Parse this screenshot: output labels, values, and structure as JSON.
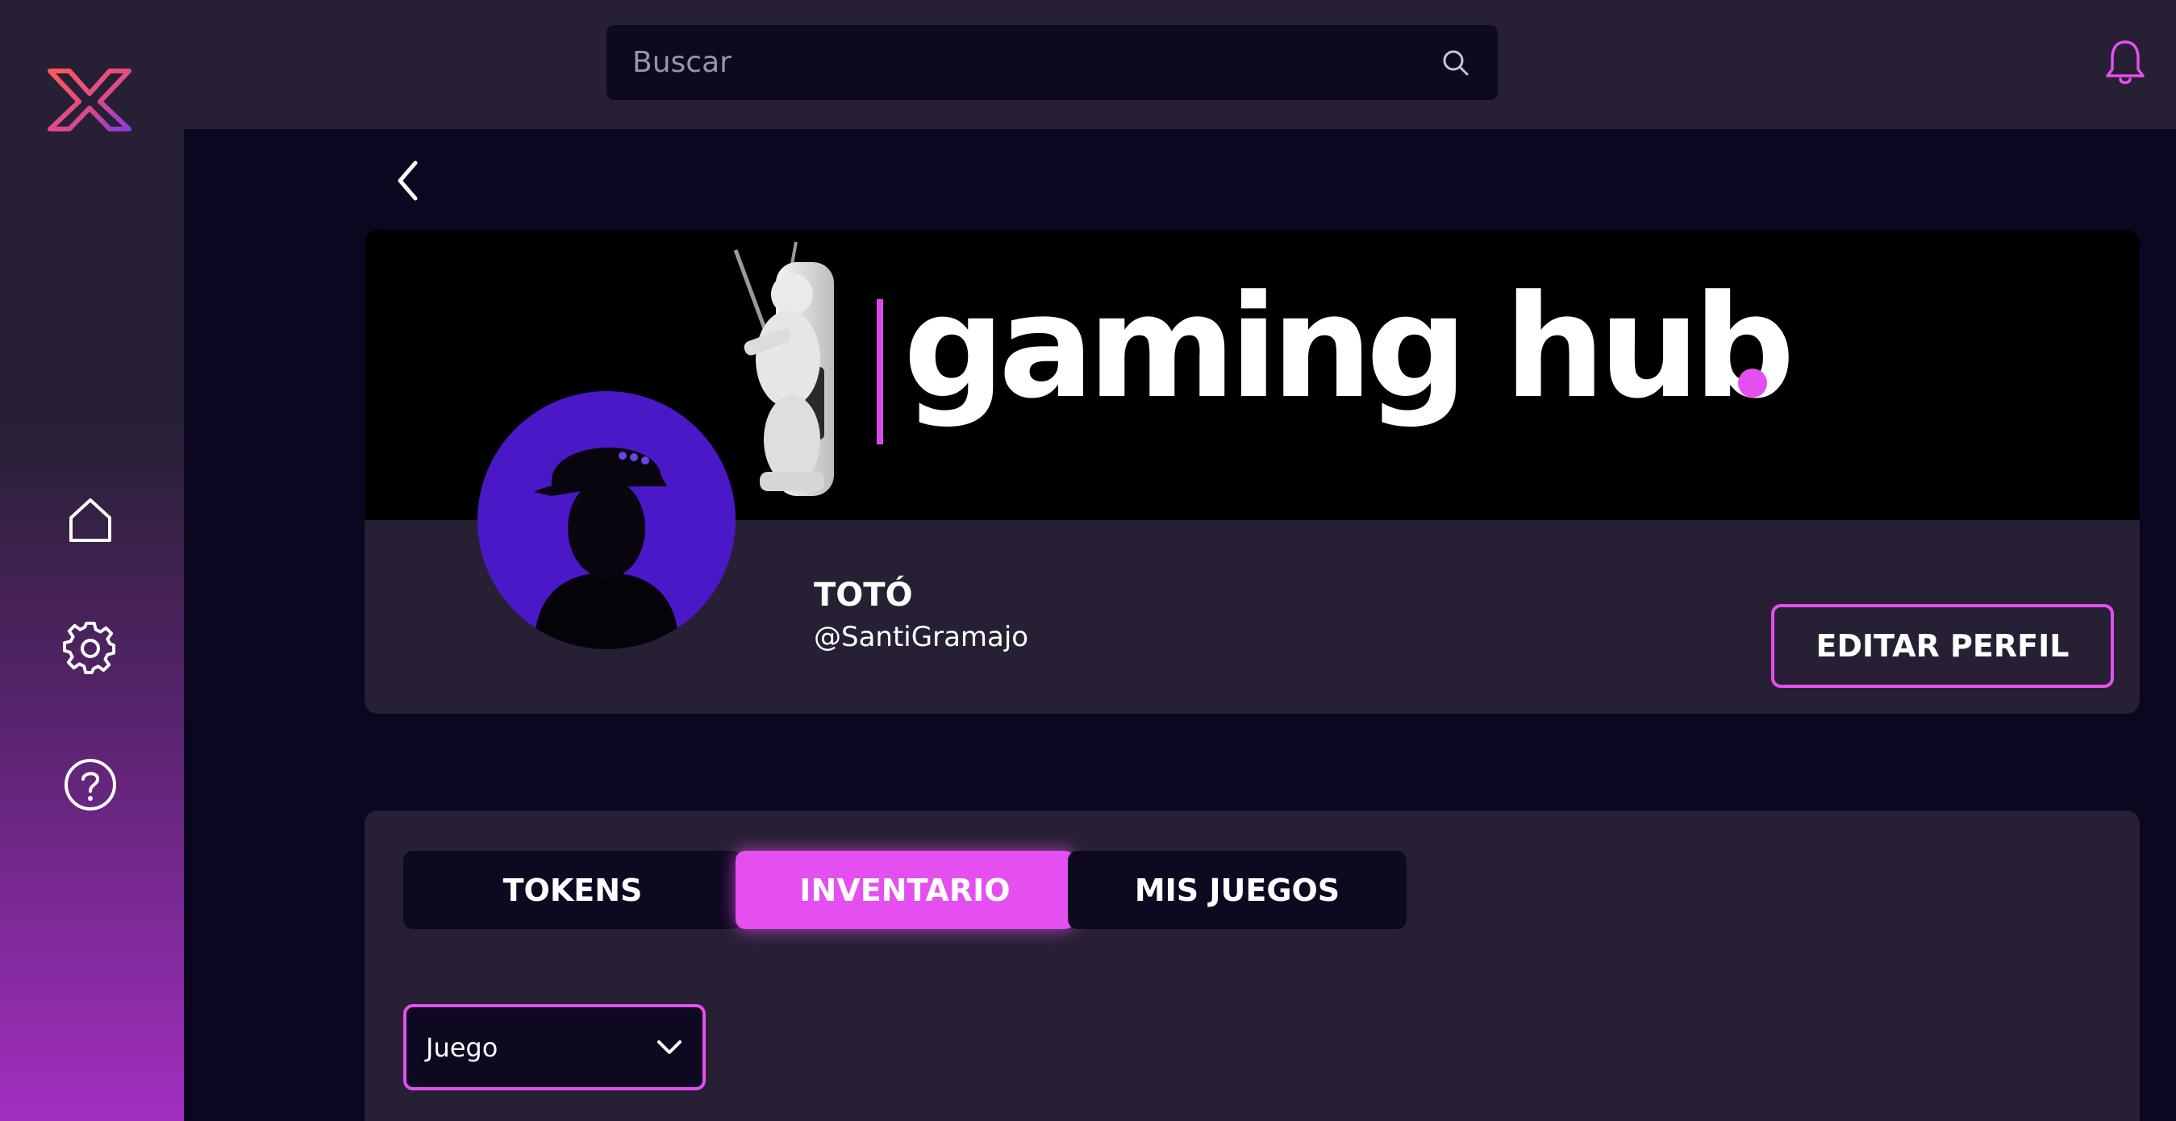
{
  "app": {
    "accent_color": "#e54ff0",
    "background_color": "#0c0620",
    "panel_color": "#272034"
  },
  "sidebar": {
    "logo": "x-logo",
    "items": [
      {
        "icon": "home-icon"
      },
      {
        "icon": "gear-icon"
      },
      {
        "icon": "help-icon"
      }
    ]
  },
  "search": {
    "placeholder": "Buscar",
    "value": "",
    "icon": "search-icon"
  },
  "header": {
    "notifications_icon": "bell-icon"
  },
  "profile": {
    "back_icon": "chevron-left-icon",
    "banner_text": "gaming hub",
    "name": "TOTÓ",
    "handle": "@SantiGramajo",
    "edit_button": "EDITAR PERFIL"
  },
  "tabs": [
    {
      "label": "TOKENS",
      "active": false
    },
    {
      "label": "INVENTARIO",
      "active": true
    },
    {
      "label": "MIS JUEGOS",
      "active": false
    }
  ],
  "filter": {
    "selected": "Juego",
    "icon": "chevron-down-icon"
  }
}
